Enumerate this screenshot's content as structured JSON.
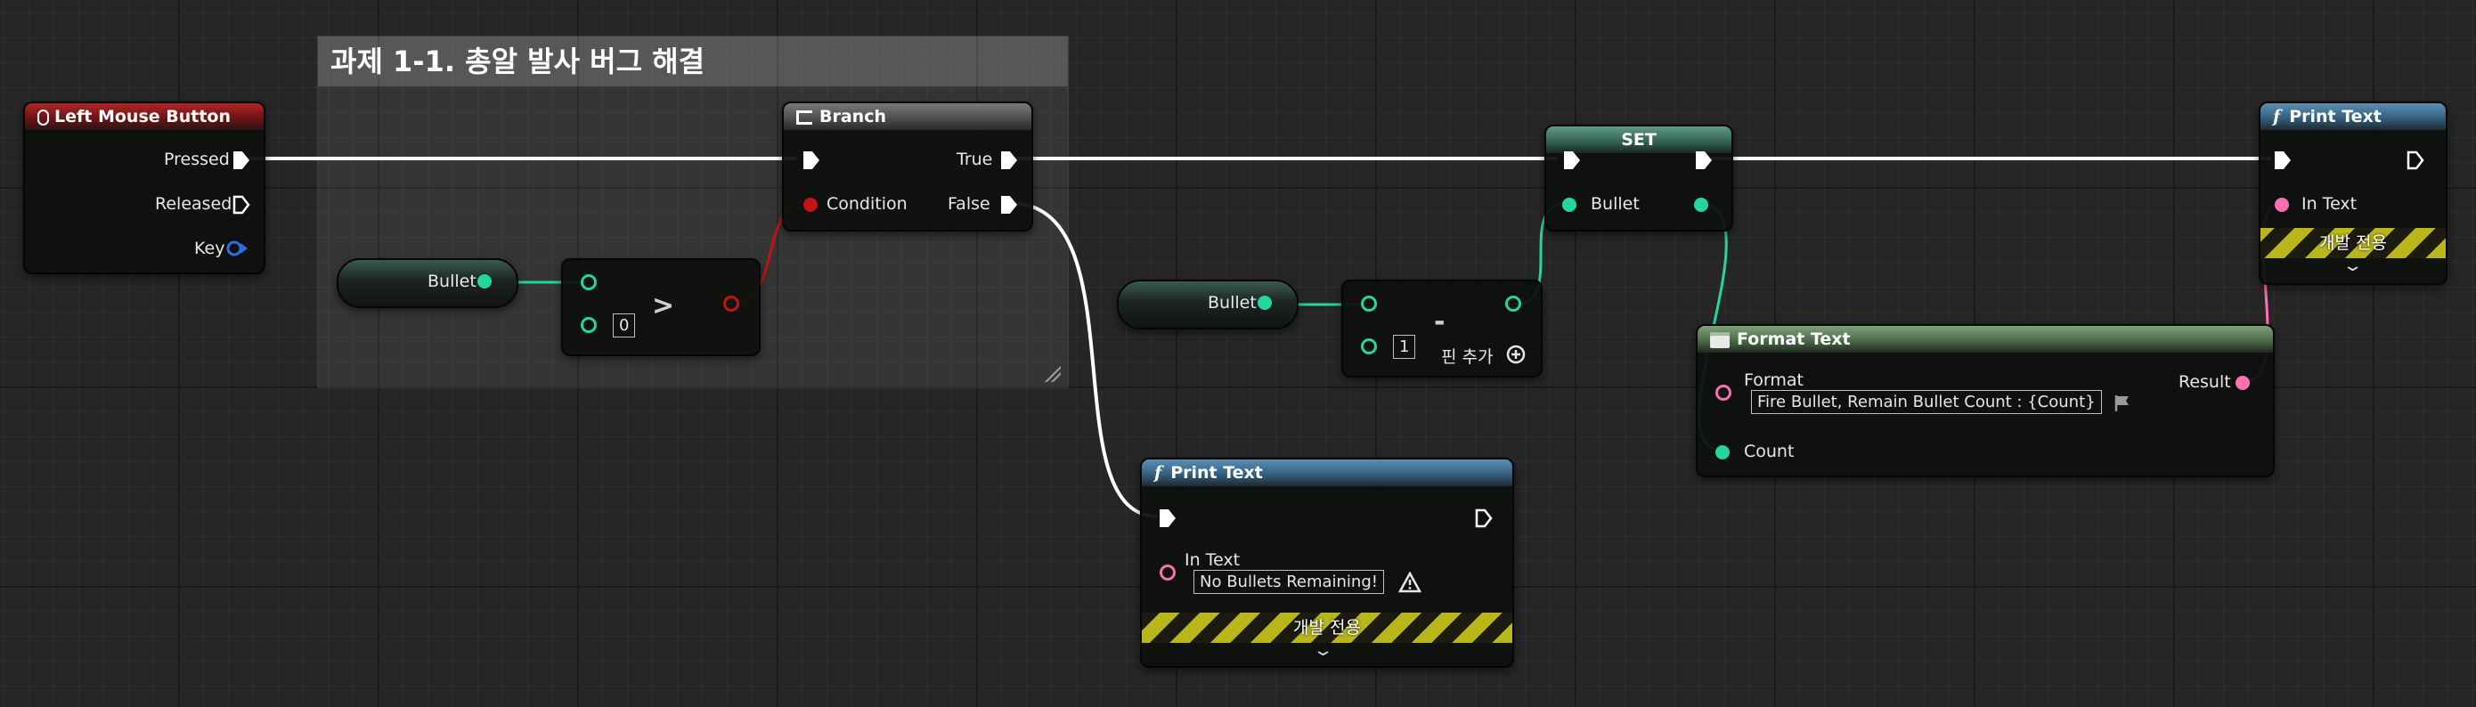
{
  "comment": {
    "title": "과제 1-1. 총알 발사 버그 해결"
  },
  "left_mouse_button": {
    "title": "Left Mouse Button",
    "pins": {
      "pressed": "Pressed",
      "released": "Released",
      "key": "Key"
    }
  },
  "branch": {
    "title": "Branch",
    "pins": {
      "condition": "Condition",
      "true": "True",
      "false": "False"
    }
  },
  "bullet_var_1": {
    "label": "Bullet"
  },
  "greater_node": {
    "operator": ">",
    "literal": "0"
  },
  "bullet_var_2": {
    "label": "Bullet"
  },
  "subtract_node": {
    "operator": "-",
    "literal": "1",
    "add_pin_label": "핀 추가"
  },
  "set_node": {
    "title": "SET",
    "pin_label": "Bullet"
  },
  "print_text_bottom": {
    "title": "Print Text",
    "in_text_label": "In Text",
    "in_text_value": "No Bullets Remaining!",
    "dev_only_label": "개발 전용"
  },
  "format_text": {
    "title": "Format Text",
    "format_label": "Format",
    "format_value": "Fire Bullet, Remain Bullet Count : {Count}",
    "result_label": "Result",
    "count_label": "Count"
  },
  "print_text_right": {
    "title": "Print Text",
    "in_text_label": "In Text",
    "dev_only_label": "개발 전용"
  },
  "colors": {
    "exec_wire": "#ffffff",
    "int_pin": "#23d6a0",
    "string_pin": "#ff6fb1",
    "bool_pin": "#c21414",
    "key_pin": "#2d6ee6",
    "dev_stripe": "#b9b61a"
  }
}
